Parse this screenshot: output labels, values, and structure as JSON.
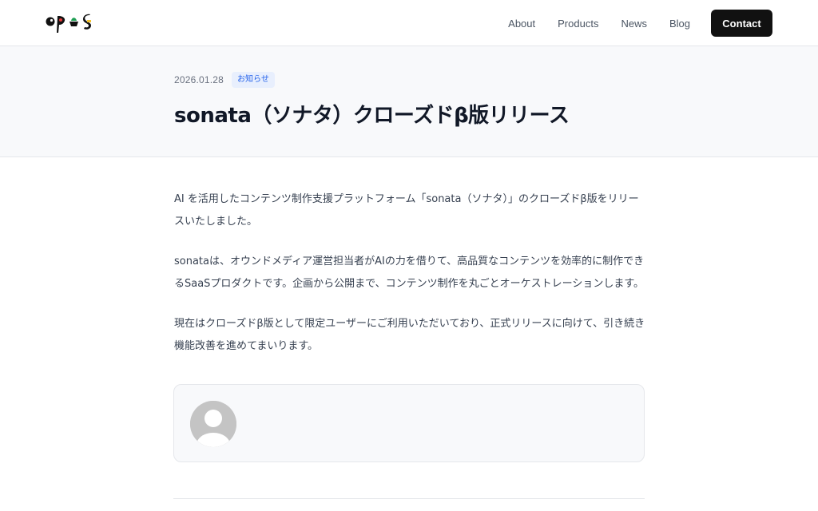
{
  "header": {
    "logo_text": "opus",
    "nav": [
      "About",
      "Products",
      "News",
      "Blog"
    ],
    "contact_label": "Contact"
  },
  "post": {
    "date": "2026.01.28",
    "category": "お知らせ",
    "title": "sonata（ソナタ）クローズドβ版リリース",
    "paragraphs": [
      "AI を活用したコンテンツ制作支援プラットフォーム「sonata（ソナタ）」のクローズドβ版をリリースいたしました。",
      "sonataは、オウンドメディア運営担当者がAIの力を借りて、高品質なコンテンツを効率的に制作できるSaaSプロダクトです。企画から公開まで、コンテンツ制作を丸ごとオーケストレーションします。",
      "現在はクローズドβ版として限定ユーザーにご利用いただいており、正式リリースに向けて、引き続き機能改善を進めてまいります。"
    ]
  },
  "colors": {
    "accent_blue": "#2563eb",
    "contact_bg": "#111111",
    "hero_bg": "#f8f9fb"
  }
}
